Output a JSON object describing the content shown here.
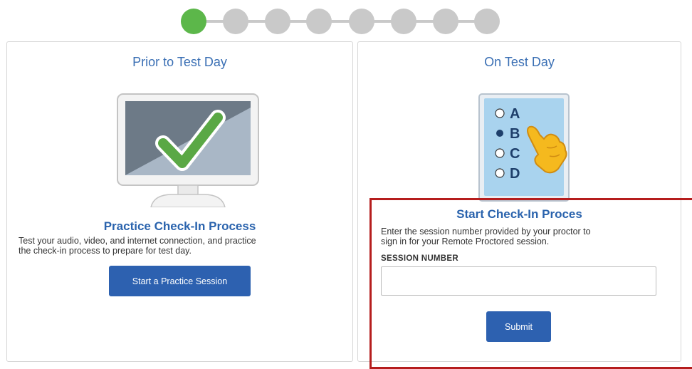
{
  "stepper": {
    "total_steps": 8,
    "active_step": 1,
    "active_color": "#5cb74a",
    "inactive_color": "#c9c9c9"
  },
  "prior": {
    "title": "Prior to Test Day",
    "icon": "monitor-checkmark-icon",
    "heading": "Practice Check-In Process",
    "description_line1": "Test your audio, video, and internet connection, and practice",
    "description_line2": "the check-in process to prepare for test day.",
    "button_label": "Start a Practice Session"
  },
  "ontest": {
    "title": "On Test Day",
    "icon": "answer-sheet-icon",
    "options": [
      "A",
      "B",
      "C",
      "D"
    ],
    "selected_option": "B",
    "heading": "Start Check-In Proces",
    "description_line1": "Enter the session number provided by your proctor to",
    "description_line2": "sign in for your Remote Proctored session.",
    "session_label": "SESSION NUMBER",
    "session_value": "",
    "session_placeholder": "",
    "submit_label": "Submit"
  },
  "colors": {
    "primary_button": "#2d61b0",
    "title_blue": "#3a6fb4",
    "highlight_red": "#b51d1d"
  }
}
